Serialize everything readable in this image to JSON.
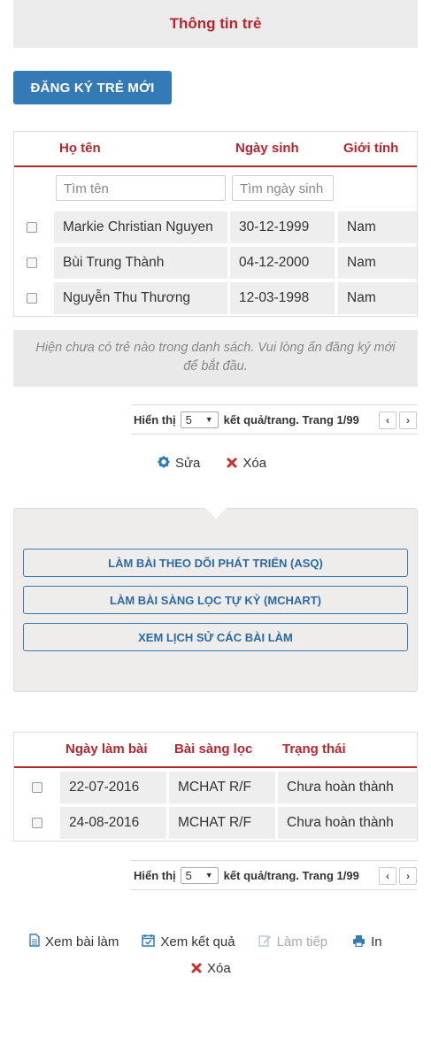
{
  "header": {
    "title": "Thông tin trẻ"
  },
  "register_button": "ĐĂNG KÝ TRẺ MỚI",
  "children_table": {
    "columns": [
      "Họ tên",
      "Ngày sinh",
      "Giới tính"
    ],
    "filters": {
      "name_placeholder": "Tìm tên",
      "dob_placeholder": "Tìm ngày sinh"
    },
    "rows": [
      {
        "name": "Markie Christian Nguyen",
        "dob": "30-12-1999",
        "gender": "Nam"
      },
      {
        "name": "Bùi Trung Thành",
        "dob": "04-12-2000",
        "gender": "Nam"
      },
      {
        "name": "Nguyễn Thu Thương",
        "dob": "12-03-1998",
        "gender": "Nam"
      }
    ]
  },
  "empty_message": "Hiện chưa có trẻ nào trong danh sách. Vui lòng ấn đăng ký mới để bắt đầu.",
  "pager1": {
    "show_label": "Hiển thị",
    "per_page": "5",
    "suffix": "kết quả/trang. Trang 1/99",
    "prev": "‹",
    "next": "›"
  },
  "child_actions": {
    "edit": "Sửa",
    "delete": "Xóa"
  },
  "panel": {
    "buttons": [
      "LÀM BÀI THEO DÕI PHÁT TRIỂN (ASQ)",
      "LÀM BÀI SÀNG LỌC TỰ KỶ (MCHART)",
      "XEM LỊCH SỬ CÁC BÀI LÀM"
    ]
  },
  "tests_table": {
    "columns": [
      "Ngày làm bài",
      "Bài sàng lọc",
      "Trạng thái"
    ],
    "rows": [
      {
        "date": "22-07-2016",
        "test": "MCHAT R/F",
        "status": "Chưa hoàn thành"
      },
      {
        "date": "24-08-2016",
        "test": "MCHAT R/F",
        "status": "Chưa hoàn thành"
      }
    ]
  },
  "pager2": {
    "show_label": "Hiển thị",
    "per_page": "5",
    "suffix": "kết quả/trang. Trang 1/99",
    "prev": "‹",
    "next": "›"
  },
  "test_actions": {
    "view": "Xem bài làm",
    "result": "Xem kết quả",
    "continue": "Làm tiếp",
    "print": "In",
    "delete": "Xóa"
  },
  "colors": {
    "accent_red": "#b5262f",
    "primary_blue": "#337ab7",
    "disabled": "#aaaaaa"
  },
  "icons": [
    "gear-icon",
    "x-icon",
    "file-icon",
    "calendar-check-icon",
    "pencil-icon",
    "print-icon"
  ]
}
